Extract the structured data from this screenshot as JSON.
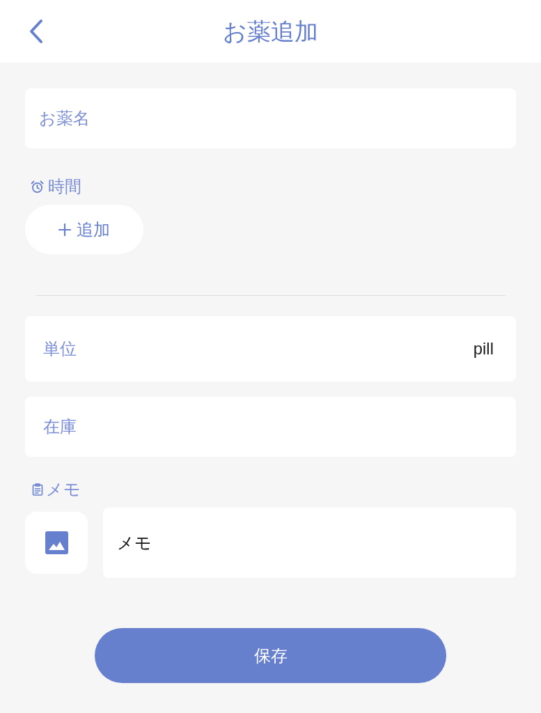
{
  "header": {
    "title": "お薬追加"
  },
  "name_field": {
    "placeholder": "お薬名"
  },
  "time_section": {
    "label": "時間",
    "add_button": "追加"
  },
  "settings": [
    {
      "kind": "select",
      "label": "単位",
      "value": "pill"
    },
    {
      "kind": "input",
      "placeholder": "在庫"
    }
  ],
  "memo_section": {
    "label": "メモ",
    "value": "メモ"
  },
  "save_button": "保存"
}
